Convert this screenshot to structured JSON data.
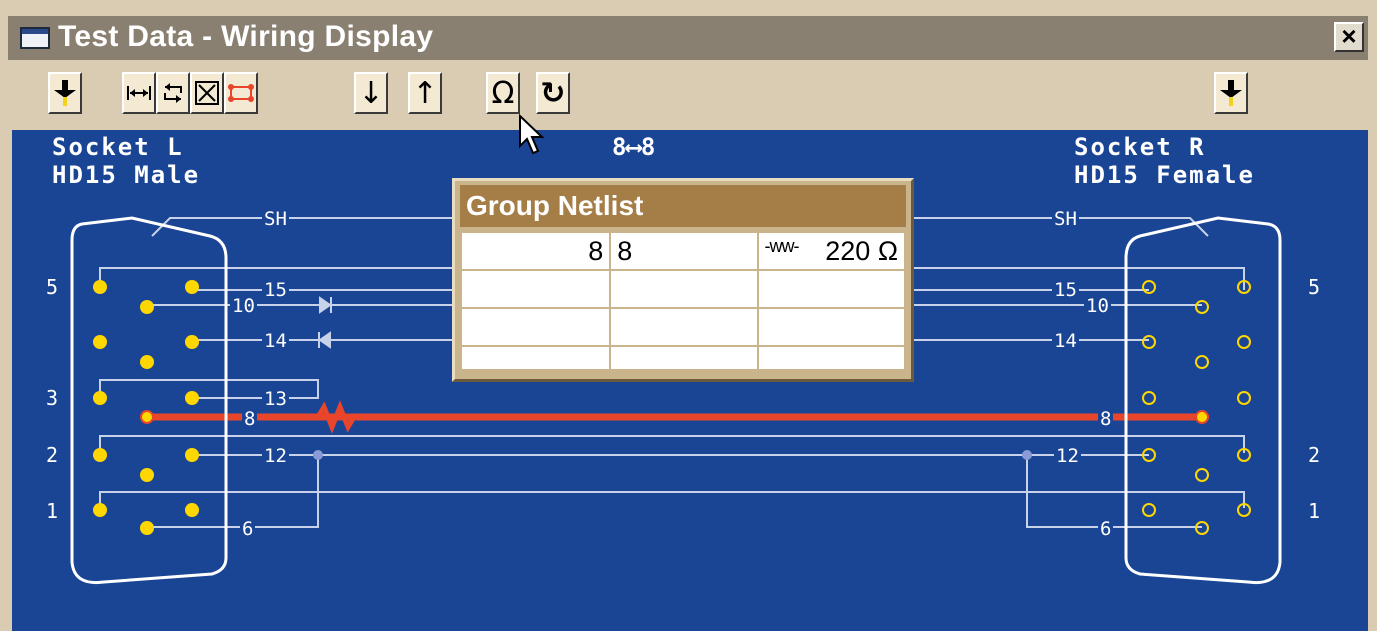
{
  "window": {
    "title": "Test Data - Wiring Display",
    "close_label": "✕"
  },
  "toolbar": {
    "buttons": [
      {
        "name": "left-connector-button",
        "icon": "connector-pin-icon"
      },
      {
        "name": "stretch-button",
        "icon": "stretch-horizontal-icon"
      },
      {
        "name": "swap-button",
        "icon": "swap-arrows-icon"
      },
      {
        "name": "expand-button",
        "icon": "expand-icon"
      },
      {
        "name": "link-button",
        "icon": "link-red-icon"
      },
      {
        "name": "move-down-button",
        "icon": "arrow-down-icon",
        "glyph": "↓"
      },
      {
        "name": "move-up-button",
        "icon": "arrow-up-icon",
        "glyph": "↑"
      },
      {
        "name": "ohm-button",
        "icon": "ohm-icon",
        "glyph": "Ω"
      },
      {
        "name": "refresh-button",
        "icon": "refresh-icon",
        "glyph": "↻"
      },
      {
        "name": "right-connector-button",
        "icon": "connector-pin-icon"
      }
    ]
  },
  "wiring": {
    "left_socket": {
      "name": "Socket L",
      "type": "HD15 Male",
      "row_labels": [
        "5",
        "3",
        "2",
        "1"
      ]
    },
    "right_socket": {
      "name": "Socket R",
      "type": "HD15 Female",
      "row_labels": [
        "5",
        "2",
        "1"
      ]
    },
    "center_label": "8⟷8",
    "left_wire_labels": [
      "SH",
      "15",
      "10",
      "14",
      "13",
      "8",
      "12",
      "6"
    ],
    "right_wire_labels": [
      "SH",
      "15",
      "10",
      "14",
      "8",
      "12",
      "6"
    ],
    "highlight_color": "#e8452a",
    "background_color": "#1a4595",
    "pin_color_left": "#ffd700",
    "pin_color_right": "#ffd700"
  },
  "netlist": {
    "title": "Group Netlist",
    "rows": [
      {
        "from": "8",
        "to": "8",
        "symbol": "-ww-",
        "value": "220 Ω"
      },
      {
        "from": "",
        "to": "",
        "symbol": "",
        "value": ""
      },
      {
        "from": "",
        "to": "",
        "symbol": "",
        "value": ""
      },
      {
        "from": "",
        "to": "",
        "symbol": "",
        "value": ""
      }
    ]
  }
}
